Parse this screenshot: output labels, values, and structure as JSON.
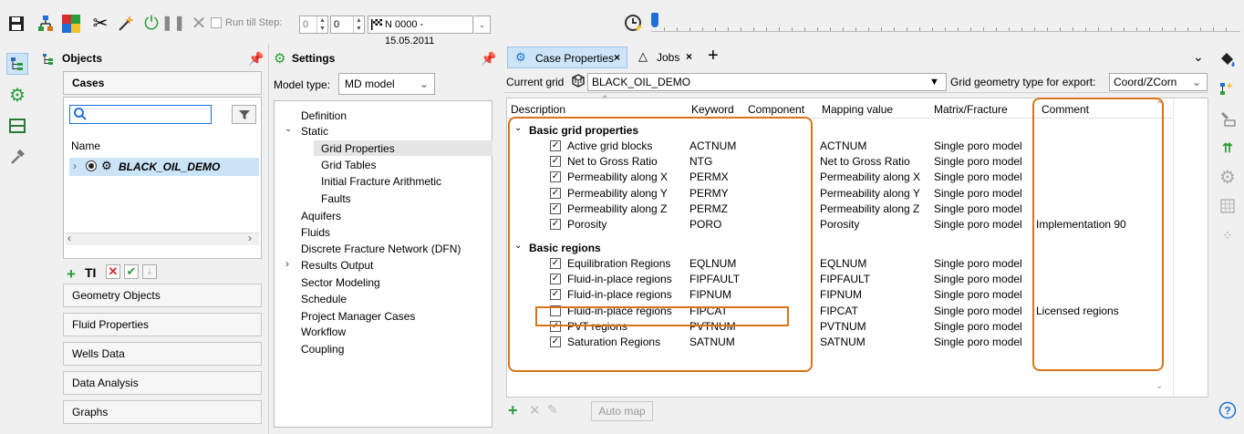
{
  "toolbar": {
    "run_till_step_label": "Run till Step:",
    "step_value_1": "0",
    "step_value_2": "0",
    "date_select": "N 0000 - 15.05.2011"
  },
  "objects_panel": {
    "title": "Objects",
    "cases_header": "Cases",
    "search_value": "",
    "name_header": "Name",
    "case_name": "BLACK_OIL_DEMO",
    "accordion": [
      "Geometry Objects",
      "Fluid Properties",
      "Wells Data",
      "Data Analysis",
      "Graphs"
    ]
  },
  "settings_panel": {
    "title": "Settings",
    "model_type_label": "Model type:",
    "model_type_value": "MD model",
    "tree": [
      {
        "label": "Definition"
      },
      {
        "label": "Static"
      },
      {
        "label": "Grid Properties"
      },
      {
        "label": "Grid Tables"
      },
      {
        "label": "Initial Fracture Arithmetic"
      },
      {
        "label": "Faults"
      },
      {
        "label": "Aquifers"
      },
      {
        "label": "Fluids"
      },
      {
        "label": "Discrete Fracture Network (DFN)"
      },
      {
        "label": "Results Output"
      },
      {
        "label": "Sector Modeling"
      },
      {
        "label": "Schedule"
      },
      {
        "label": "Project Manager Cases"
      },
      {
        "label": "Workflow"
      },
      {
        "label": "Coupling"
      }
    ]
  },
  "main": {
    "tabs": [
      {
        "label": "Case Properties"
      },
      {
        "label": "Jobs"
      }
    ],
    "current_grid_label": "Current grid",
    "current_grid_value": "BLACK_OIL_DEMO",
    "export_label": "Grid geometry type for export:",
    "export_value": "Coord/ZCorn",
    "columns": [
      "Description",
      "Keyword",
      "Component",
      "Mapping value",
      "Matrix/Fracture",
      "Comment"
    ],
    "groups": [
      {
        "label": "Basic grid properties",
        "rows": [
          {
            "checked": true,
            "description": "Active grid blocks",
            "keyword": "ACTNUM",
            "mapping": "ACTNUM",
            "matrix": "Single poro model",
            "comment": ""
          },
          {
            "checked": true,
            "description": "Net to Gross Ratio",
            "keyword": "NTG",
            "mapping": "Net to Gross Ratio",
            "matrix": "Single poro model",
            "comment": ""
          },
          {
            "checked": true,
            "description": "Permeability along X",
            "keyword": "PERMX",
            "mapping": "Permeability along X",
            "matrix": "Single poro model",
            "comment": ""
          },
          {
            "checked": true,
            "description": "Permeability along Y",
            "keyword": "PERMY",
            "mapping": "Permeability along Y",
            "matrix": "Single poro model",
            "comment": ""
          },
          {
            "checked": true,
            "description": "Permeability along Z",
            "keyword": "PERMZ",
            "mapping": "Permeability along Z",
            "matrix": "Single poro model",
            "comment": ""
          },
          {
            "checked": true,
            "description": "Porosity",
            "keyword": "PORO",
            "mapping": "Porosity",
            "matrix": "Single poro model",
            "comment": "Implementation 90"
          }
        ]
      },
      {
        "label": "Basic regions",
        "rows": [
          {
            "checked": true,
            "description": "Equilibration Regions",
            "keyword": "EQLNUM",
            "mapping": "EQLNUM",
            "matrix": "Single poro model",
            "comment": ""
          },
          {
            "checked": true,
            "description": "Fluid-in-place regions",
            "keyword": "FIPFAULT",
            "mapping": "FIPFAULT",
            "matrix": "Single poro model",
            "comment": ""
          },
          {
            "checked": true,
            "description": "Fluid-in-place regions",
            "keyword": "FIPNUM",
            "mapping": "FIPNUM",
            "matrix": "Single poro model",
            "comment": ""
          },
          {
            "checked": false,
            "description": "Fluid-in-place regions",
            "keyword": "FIPCAT",
            "mapping": "FIPCAT",
            "matrix": "Single poro model",
            "comment": "Licensed regions"
          },
          {
            "checked": true,
            "description": "PVT regions",
            "keyword": "PVTNUM",
            "mapping": "PVTNUM",
            "matrix": "Single poro model",
            "comment": ""
          },
          {
            "checked": true,
            "description": "Saturation Regions",
            "keyword": "SATNUM",
            "mapping": "SATNUM",
            "matrix": "Single poro model",
            "comment": ""
          }
        ]
      }
    ],
    "auto_map_label": "Auto map"
  },
  "colors": {
    "highlight_orange": "#d9731a",
    "highlight_red": "#b22020",
    "selection_blue": "#cce4f7",
    "accent_blue": "#1e6fd9"
  }
}
